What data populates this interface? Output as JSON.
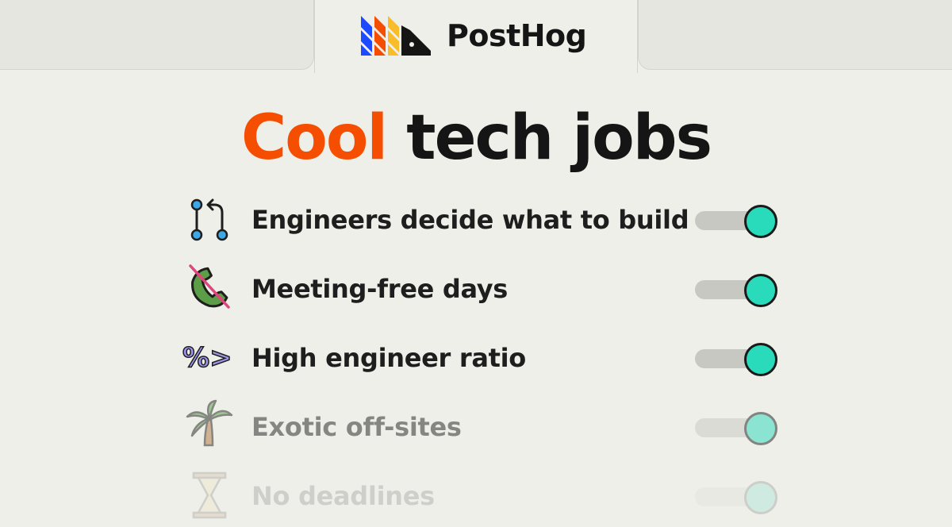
{
  "brand": {
    "name": "PostHog"
  },
  "headline": {
    "accent": "Cool",
    "rest": "tech jobs"
  },
  "colors": {
    "accent": "#F54E00",
    "toggle_on": "#29DBBB",
    "background": "#EEEFE9",
    "text": "#1E1E1E"
  },
  "features": [
    {
      "label": "Engineers decide what to build",
      "icon": "git-branch-icon",
      "enabled": true
    },
    {
      "label": "Meeting-free days",
      "icon": "no-phone-icon",
      "enabled": true
    },
    {
      "label": "High engineer ratio",
      "icon": "percent-greater-icon",
      "enabled": true
    },
    {
      "label": "Exotic off-sites",
      "icon": "palm-tree-icon",
      "enabled": true
    },
    {
      "label": "No deadlines",
      "icon": "hourglass-icon",
      "enabled": true
    }
  ]
}
